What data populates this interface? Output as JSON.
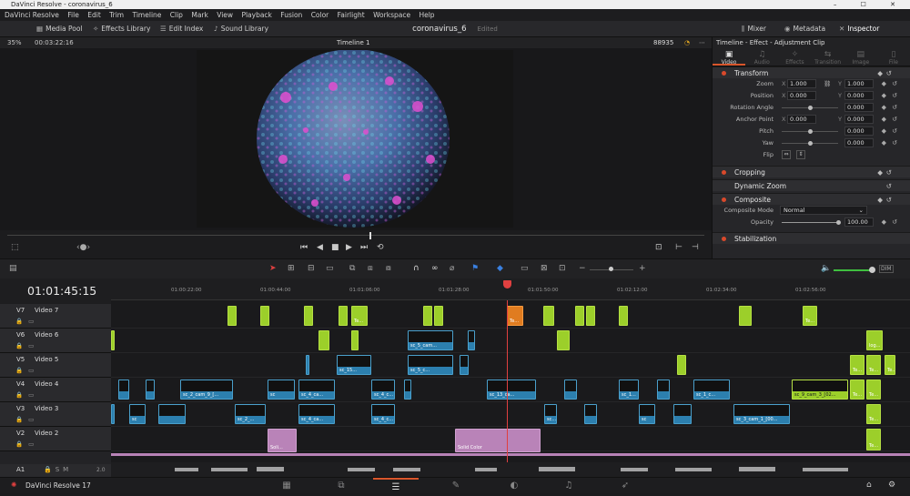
{
  "window": {
    "title": "DaVinci Resolve - coronavirus_6",
    "controls": "– ☐ ✕"
  },
  "menu": [
    "DaVinci Resolve",
    "File",
    "Edit",
    "Trim",
    "Timeline",
    "Clip",
    "Mark",
    "View",
    "Playback",
    "Fusion",
    "Color",
    "Fairlight",
    "Workspace",
    "Help"
  ],
  "toolbar": {
    "media_pool": "Media Pool",
    "effects_library": "Effects Library",
    "edit_index": "Edit Index",
    "sound_library": "Sound Library",
    "project_name": "coronavirus_6",
    "project_status": "Edited",
    "mixer": "Mixer",
    "metadata": "Metadata",
    "inspector": "Inspector"
  },
  "viewer": {
    "zoom": "35%",
    "timecode": "00:03:22:16",
    "timeline_name": "Timeline 1",
    "frame_count": "88935"
  },
  "inspector": {
    "title": "Timeline - Effect - Adjustment Clip",
    "tabs": [
      {
        "label": "Video",
        "icon": "▣",
        "active": true
      },
      {
        "label": "Audio",
        "icon": "♫"
      },
      {
        "label": "Effects",
        "icon": "✧"
      },
      {
        "label": "Transition",
        "icon": "⇆"
      },
      {
        "label": "Image",
        "icon": "▤"
      },
      {
        "label": "File",
        "icon": "▯"
      }
    ],
    "transform": {
      "label": "Transform",
      "zoom": {
        "label": "Zoom",
        "x": "1.000",
        "y": "1.000"
      },
      "position": {
        "label": "Position",
        "x": "0.000",
        "y": "0.000"
      },
      "rotation": {
        "label": "Rotation Angle",
        "value": "0.000"
      },
      "anchor": {
        "label": "Anchor Point",
        "x": "0.000",
        "y": "0.000"
      },
      "pitch": {
        "label": "Pitch",
        "value": "0.000"
      },
      "yaw": {
        "label": "Yaw",
        "value": "0.000"
      },
      "flip": {
        "label": "Flip"
      }
    },
    "cropping": "Cropping",
    "dynamic_zoom": "Dynamic Zoom",
    "composite": {
      "label": "Composite",
      "mode_label": "Composite Mode",
      "mode_value": "Normal",
      "opacity_label": "Opacity",
      "opacity_value": "100.00"
    },
    "stabilization": "Stabilization"
  },
  "timeline": {
    "timecode": "01:01:45:15",
    "ruler": [
      "01:00:22:00",
      "01:00:44:00",
      "01:01:06:00",
      "01:01:28:00",
      "01:01:50:00",
      "01:02:12:00",
      "01:02:34:00",
      "01:02:56:00"
    ],
    "tracks": [
      {
        "id": "V7",
        "name": "Video 7"
      },
      {
        "id": "V6",
        "name": "Video 6"
      },
      {
        "id": "V5",
        "name": "Video 5"
      },
      {
        "id": "V4",
        "name": "Video 4"
      },
      {
        "id": "V3",
        "name": "Video 3"
      },
      {
        "id": "V2",
        "name": "Video 2"
      }
    ],
    "audio_track": {
      "id": "A1",
      "level": "2.0"
    },
    "clips": {
      "te": "Te...",
      "sc5cam": "sc_5_cam...",
      "sc5c": "sc_5_c...",
      "sc15": "sc_15...",
      "sc2cam9": "sc_2_cam_9_[...",
      "sc4ca": "sc_4_ca...",
      "sc4c": "sc_4_c...",
      "sc13ca": "sc_13_ca...",
      "sc1": "sc_1...",
      "sc1c": "sc_1_c...",
      "sc9cam3": "sc_9_cam_3_[02...",
      "sc2": "sc_2_...",
      "sc3cam1": "sc_3_cam_1_[00...",
      "sol": "Soli...",
      "solid_color": "Solid Color",
      "log": "log...",
      "sc": "sc",
      "scd": "sc..."
    }
  },
  "bottom": {
    "app_name": "DaVinci Resolve 17"
  }
}
